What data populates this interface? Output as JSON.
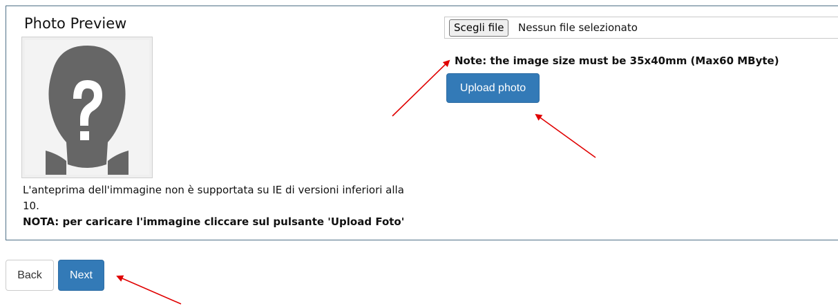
{
  "preview": {
    "title": "Photo Preview",
    "placeholder_icon": "unknown-person-question-icon",
    "note_line1": "L'anteprima dell'immagine non è supportata su IE di versioni inferiori alla 10.",
    "note_strong": "NOTA: per caricare l'immagine cliccare sul pulsante 'Upload Foto'"
  },
  "upload": {
    "choose_file_label": "Scegli file",
    "file_status": "Nessun file selezionato",
    "size_note": "Note: the image size must be 35x40mm (Max60 MByte)",
    "upload_button": "Upload photo"
  },
  "footer": {
    "back_label": "Back",
    "next_label": "Next"
  },
  "colors": {
    "primary": "#337ab7",
    "panel_border": "#4e6f86",
    "annotation_arrow": "#e00000",
    "silhouette": "#666666"
  }
}
